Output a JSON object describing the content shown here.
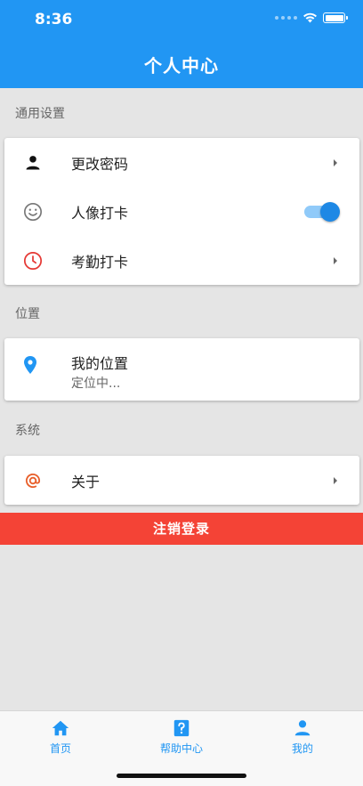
{
  "status_bar": {
    "time": "8:36"
  },
  "header": {
    "title": "个人中心"
  },
  "sections": {
    "general": {
      "label": "通用设置",
      "items": [
        {
          "label": "更改密码",
          "icon": "person-icon",
          "accessory": "chevron"
        },
        {
          "label": "人像打卡",
          "icon": "smiley-icon",
          "accessory": "toggle",
          "toggle_on": true
        },
        {
          "label": "考勤打卡",
          "icon": "clock-icon",
          "accessory": "chevron"
        }
      ]
    },
    "location": {
      "label": "位置",
      "title": "我的位置",
      "subtitle": "定位中..."
    },
    "system": {
      "label": "系统",
      "items": [
        {
          "label": "关于",
          "icon": "at-sign-icon",
          "accessory": "chevron"
        }
      ]
    }
  },
  "logout_button": {
    "label": "注销登录"
  },
  "tabbar": {
    "tabs": [
      {
        "label": "首页",
        "icon": "home-icon"
      },
      {
        "label": "帮助中心",
        "icon": "help-icon"
      },
      {
        "label": "我的",
        "icon": "person-icon"
      }
    ]
  },
  "colors": {
    "primary": "#2196f3",
    "danger": "#f44336",
    "clock_icon": "#e53935",
    "at_icon": "#e8602c",
    "background": "#e5e5e5"
  }
}
